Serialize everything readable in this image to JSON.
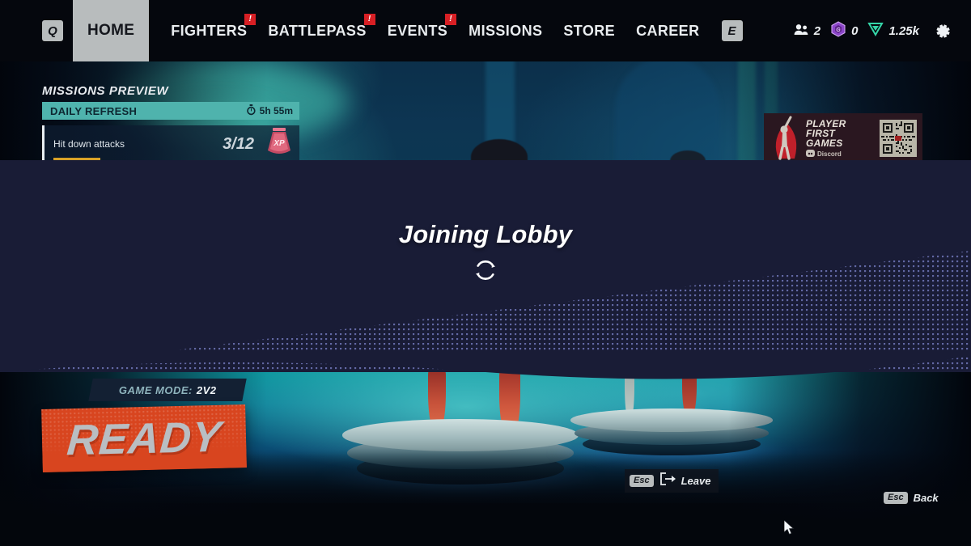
{
  "nav": {
    "prev_key": "Q",
    "next_key": "E",
    "active_tab": "HOME",
    "items": [
      {
        "label": "FIGHTERS",
        "badge": "!"
      },
      {
        "label": "BATTLEPASS",
        "badge": "!"
      },
      {
        "label": "EVENTS",
        "badge": "!"
      },
      {
        "label": "MISSIONS",
        "badge": ""
      },
      {
        "label": "STORE",
        "badge": ""
      },
      {
        "label": "CAREER",
        "badge": ""
      }
    ]
  },
  "hud": {
    "friends_icon": "friends-icon",
    "friends_count": "2",
    "gem_icon": "gleamium-icon",
    "gem_count": "0",
    "currency_icon": "fighter-currency-icon",
    "currency_count": "1.25k",
    "settings_icon": "gear-icon"
  },
  "missions": {
    "title": "MISSIONS PREVIEW",
    "daily_label": "DAILY REFRESH",
    "timer_icon": "stopwatch-icon",
    "timer": "5h 55m",
    "rows": [
      {
        "name": "Hit down attacks",
        "progress_text": "3/12",
        "progress_pct": 25,
        "reward_icon": "xp-reward-icon"
      }
    ]
  },
  "promo_banner": {
    "line1": "PLAYER",
    "line2": "FIRST",
    "line3": "GAMES",
    "platform": "Discord",
    "platform_icon": "discord-icon",
    "qr_icon": "qr-code-icon",
    "hero_icon": "caped-hero-icon"
  },
  "overlay": {
    "title": "Joining Lobby",
    "spinner_icon": "loading-spinner-icon"
  },
  "ready_panel": {
    "game_mode_label": "GAME MODE:",
    "game_mode_value": "2V2",
    "ready_label": "READY"
  },
  "footer": {
    "leave": {
      "key": "Esc",
      "icon": "exit-door-icon",
      "label": "Leave"
    },
    "back": {
      "key": "Esc",
      "label": "Back"
    }
  },
  "colors": {
    "accent_orange": "#d8451f",
    "accent_teal": "#4fb3ad",
    "overlay_navy": "#191c36",
    "badge_red": "#d81f24",
    "progress_gold": "#d9a227"
  }
}
